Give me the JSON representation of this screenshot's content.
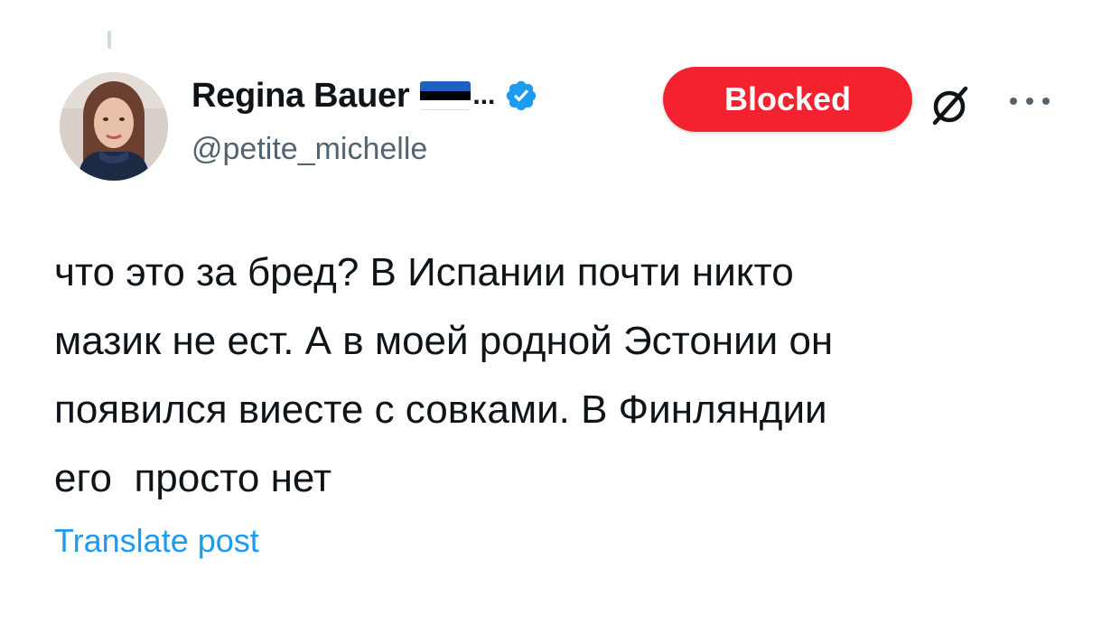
{
  "post": {
    "author": {
      "display_name": "Regina Bauer",
      "name_overflow": "...",
      "handle": "@petite_michelle",
      "flag": {
        "icon": "estonia-flag-icon",
        "colors": [
          "#1f5fbf",
          "#000000",
          "#ffffff"
        ]
      },
      "verified_icon": "verified-badge-icon",
      "verified_color": "#1d9bf0"
    },
    "blocked_button": {
      "label": "Blocked",
      "color": "#f4212e"
    },
    "grok_icon": "grok-icon",
    "more_icon": "more-options-icon",
    "text_lines": [
      "что это за бред? В Испании почти никто",
      "мазик не ест. А в моей родной Эстонии он",
      "появился виесте с совками. В Финляндии",
      "его  просто нет"
    ],
    "translate_label": "Translate post",
    "accent_color": "#1d9bf0"
  }
}
